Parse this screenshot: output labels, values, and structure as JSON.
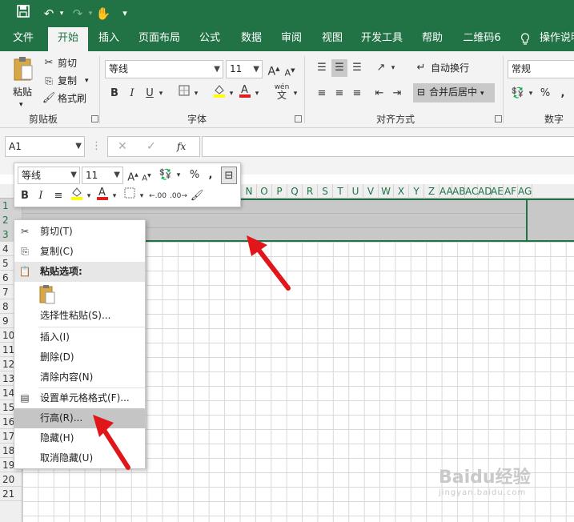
{
  "qat": {
    "save": "save-icon",
    "undo": "undo-icon",
    "redo": "redo-icon",
    "touch": "touch-mode-icon",
    "customize": "customize-icon"
  },
  "tabs": [
    "文件",
    "开始",
    "插入",
    "页面布局",
    "公式",
    "数据",
    "审阅",
    "视图",
    "开发工具",
    "帮助",
    "二维码6",
    "操作说明"
  ],
  "active_tab": "开始",
  "clipboard": {
    "paste": "粘贴",
    "cut": "剪切",
    "copy": "复制",
    "painter": "格式刷",
    "title": "剪贴板"
  },
  "font": {
    "name": "等线",
    "size": "11",
    "grow": "A",
    "shrink": "A",
    "bold": "B",
    "italic": "I",
    "underline": "U",
    "title": "字体",
    "wen": "wén",
    "wen_char": "文"
  },
  "alignment": {
    "wrap": "自动换行",
    "merge": "合并后居中",
    "title": "对齐方式"
  },
  "number": {
    "format": "常规",
    "percent": "%",
    "title": "数字"
  },
  "formula_bar": {
    "name_box": "A1",
    "fx": "fx"
  },
  "mini_toolbar": {
    "font": "等线",
    "size": "11",
    "percent": "%",
    "comma": ","
  },
  "columns": [
    "N",
    "O",
    "P",
    "Q",
    "R",
    "S",
    "T",
    "U",
    "V",
    "W",
    "X",
    "Y",
    "Z",
    "AA",
    "AB",
    "AC",
    "AD",
    "AE",
    "AF",
    "AG"
  ],
  "rows": [
    "1",
    "2",
    "3",
    "4",
    "5",
    "6",
    "7",
    "8",
    "9",
    "10",
    "11",
    "12",
    "13",
    "14",
    "15",
    "16",
    "17",
    "18",
    "19",
    "20",
    "21"
  ],
  "context_menu": {
    "cut": "剪切(T)",
    "copy": "复制(C)",
    "paste_options": "粘贴选项:",
    "paste_special": "选择性粘贴(S)...",
    "insert": "插入(I)",
    "delete": "删除(D)",
    "clear": "清除内容(N)",
    "format_cells": "设置单元格格式(F)...",
    "row_height": "行高(R)...",
    "hide": "隐藏(H)",
    "unhide": "取消隐藏(U)"
  },
  "colors": {
    "excel_green": "#217346",
    "arrow_red": "#e0161b",
    "selection_gray": "#c8c8c8"
  },
  "watermark": {
    "brand": "Baidu经验",
    "url": "jingyan.baidu.com"
  }
}
